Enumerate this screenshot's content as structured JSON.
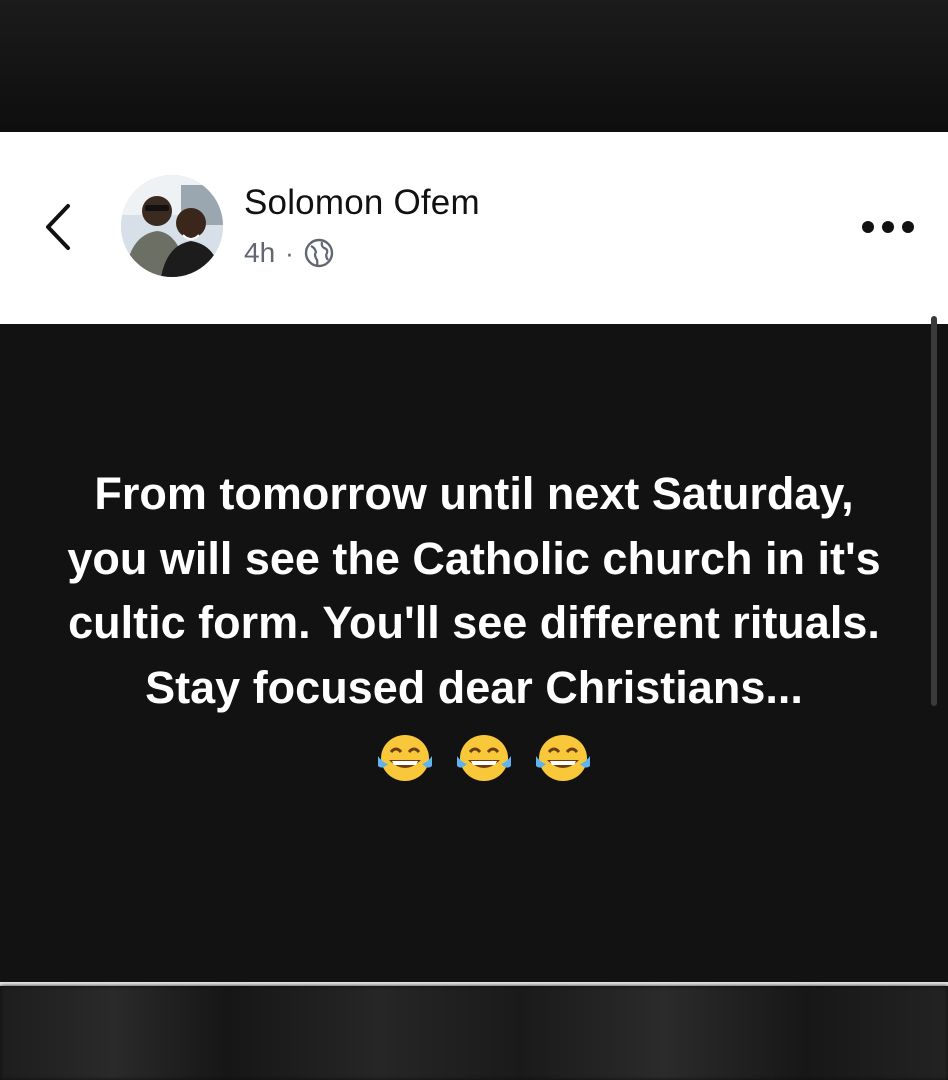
{
  "header": {
    "back_icon": "chevron-left-icon",
    "author_name": "Solomon Ofem",
    "time_ago": "4h",
    "separator": "·",
    "audience_icon": "globe-icon",
    "more_icon": "more-options-icon"
  },
  "post": {
    "text": "From tomorrow until next Saturday, you will see the Catholic church in it's cultic form. You'll see different rituals. Stay focused dear Christians...",
    "emoji_icon": "face-with-tears-of-joy-icon",
    "emoji_count": 3,
    "background_color": "#121212",
    "text_color": "#ffffff"
  }
}
